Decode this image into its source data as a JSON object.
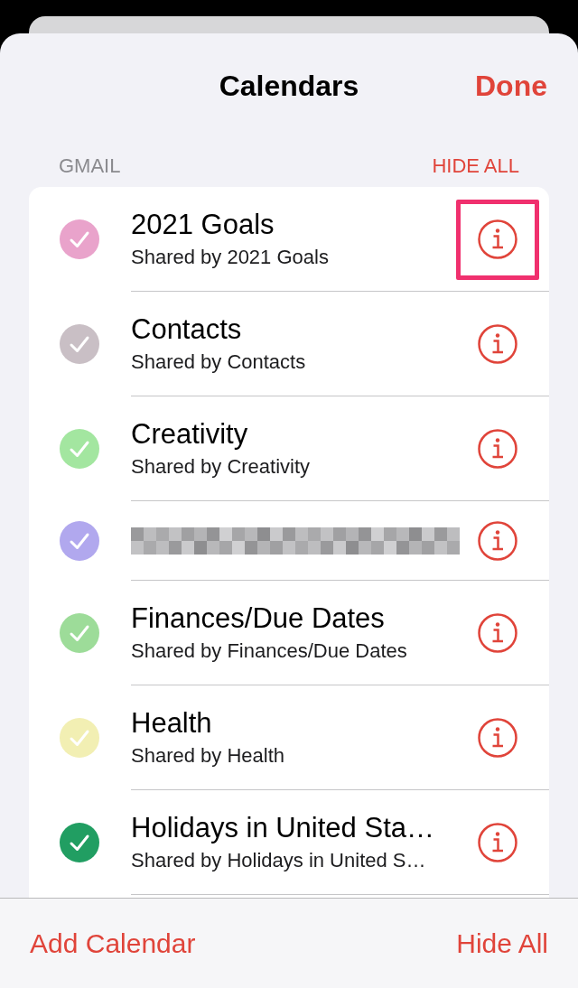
{
  "header": {
    "title": "Calendars",
    "done": "Done"
  },
  "section": {
    "title": "GMAIL",
    "action": "HIDE ALL"
  },
  "calendars": [
    {
      "kind": "calendar",
      "title": "2021 Goals",
      "subtitle": "Shared by 2021 Goals",
      "color": "#e9a3cb",
      "checked": true,
      "highlighted": true
    },
    {
      "kind": "calendar",
      "title": "Contacts",
      "subtitle": "Shared by Contacts",
      "color": "#c9bfc5",
      "checked": true,
      "highlighted": false
    },
    {
      "kind": "calendar",
      "title": "Creativity",
      "subtitle": "Shared by Creativity",
      "color": "#a3e6a0",
      "checked": true,
      "highlighted": false
    },
    {
      "kind": "redacted",
      "color": "#b1a8ee",
      "checked": true,
      "highlighted": false
    },
    {
      "kind": "calendar",
      "title": "Finances/Due Dates",
      "subtitle": "Shared by Finances/Due Dates",
      "color": "#9ddc99",
      "checked": true,
      "highlighted": false
    },
    {
      "kind": "calendar",
      "title": "Health",
      "subtitle": "Shared by Health",
      "color": "#f2efb3",
      "checked": true,
      "highlighted": false
    },
    {
      "kind": "calendar",
      "title": "Holidays in United Sta…",
      "subtitle": "Shared by Holidays in United S…",
      "color": "#219e62",
      "checked": true,
      "highlighted": false
    }
  ],
  "toolbar": {
    "add": "Add Calendar",
    "hide_all": "Hide All"
  }
}
